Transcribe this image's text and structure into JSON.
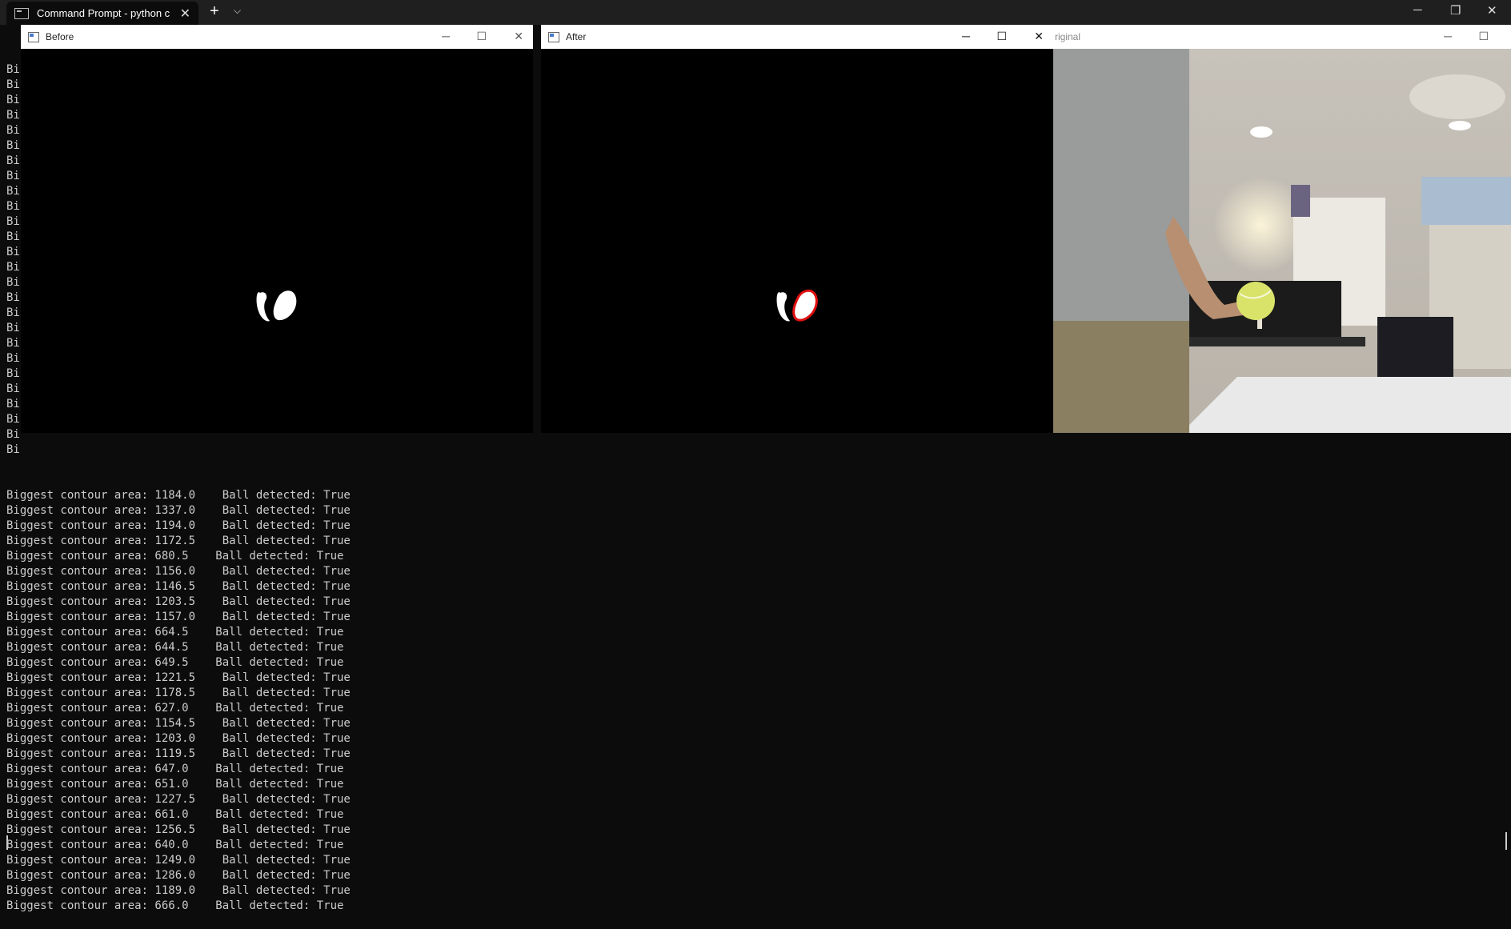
{
  "terminal": {
    "tab_title": "Command Prompt - python c",
    "tab_close": "✕",
    "new_tab": "+",
    "dropdown": "⌵",
    "minimize": "─",
    "restore": "❐",
    "close": "✕",
    "partial_prefix": "Bi",
    "output_lines": [
      "Biggest contour area: 1184.0    Ball detected: True",
      "Biggest contour area: 1337.0    Ball detected: True",
      "Biggest contour area: 1194.0    Ball detected: True",
      "Biggest contour area: 1172.5    Ball detected: True",
      "Biggest contour area: 680.5    Ball detected: True",
      "Biggest contour area: 1156.0    Ball detected: True",
      "Biggest contour area: 1146.5    Ball detected: True",
      "Biggest contour area: 1203.5    Ball detected: True",
      "Biggest contour area: 1157.0    Ball detected: True",
      "Biggest contour area: 664.5    Ball detected: True",
      "Biggest contour area: 644.5    Ball detected: True",
      "Biggest contour area: 649.5    Ball detected: True",
      "Biggest contour area: 1221.5    Ball detected: True",
      "Biggest contour area: 1178.5    Ball detected: True",
      "Biggest contour area: 627.0    Ball detected: True",
      "Biggest contour area: 1154.5    Ball detected: True",
      "Biggest contour area: 1203.0    Ball detected: True",
      "Biggest contour area: 1119.5    Ball detected: True",
      "Biggest contour area: 647.0    Ball detected: True",
      "Biggest contour area: 651.0    Ball detected: True",
      "Biggest contour area: 1227.5    Ball detected: True",
      "Biggest contour area: 661.0    Ball detected: True",
      "Biggest contour area: 1256.5    Ball detected: True",
      "Biggest contour area: 640.0    Ball detected: True",
      "Biggest contour area: 1249.0    Ball detected: True",
      "Biggest contour area: 1286.0    Ball detected: True",
      "Biggest contour area: 1189.0    Ball detected: True",
      "Biggest contour area: 666.0    Ball detected: True"
    ]
  },
  "windows": {
    "before": {
      "title": "Before",
      "minimize": "─",
      "maximize": "☐",
      "close": "✕"
    },
    "after": {
      "title": "After",
      "minimize": "─",
      "maximize": "☐",
      "close": "✕"
    },
    "original": {
      "title": "riginal",
      "minimize": "─",
      "maximize": "☐"
    }
  },
  "colors": {
    "terminal_bg": "#0c0c0c",
    "terminal_text": "#cccccc",
    "contour": "#e01010",
    "ball": "#d9e36a"
  }
}
